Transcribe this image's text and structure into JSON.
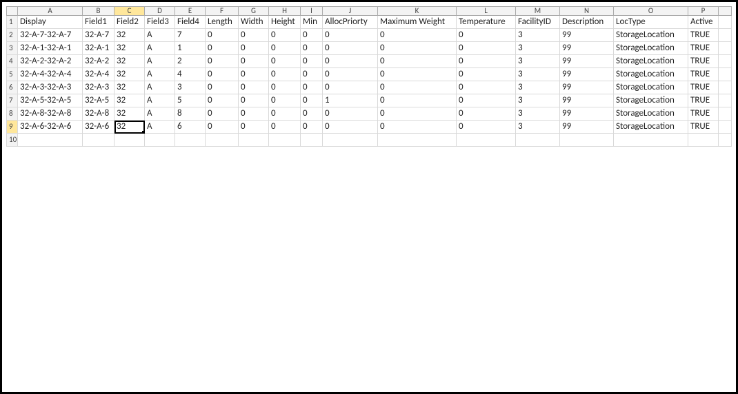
{
  "columnLetters": [
    "A",
    "B",
    "C",
    "D",
    "E",
    "F",
    "G",
    "H",
    "I",
    "J",
    "K",
    "L",
    "M",
    "N",
    "O",
    "P"
  ],
  "headerRowNumber": "1",
  "headers": {
    "Display": "Display",
    "Field1": "Field1",
    "Field2": "Field2",
    "Field3": "Field3",
    "Field4": "Field4",
    "Length": "Length",
    "Width": "Width",
    "Height": "Height",
    "Min": "Min",
    "AllocPriorty": "AllocPriorty",
    "MaximumWeight": "Maximum Weight",
    "Temperature": "Temperature",
    "FacilityID": "FacilityID",
    "Description": "Description",
    "LocType": "LocType",
    "Active": "Active"
  },
  "rows": [
    {
      "num": "2",
      "Display": "32-A-7-32-A-7",
      "Field1": "32-A-7",
      "Field2": "32",
      "Field3": "A",
      "Field4": "7",
      "Length": "0",
      "Width": "0",
      "Height": "0",
      "Min": "0",
      "AllocPriorty": "0",
      "MaximumWeight": "0",
      "Temperature": "0",
      "FacilityID": "3",
      "Description": "99",
      "LocType": "StorageLocation",
      "Active": "TRUE"
    },
    {
      "num": "3",
      "Display": "32-A-1-32-A-1",
      "Field1": "32-A-1",
      "Field2": "32",
      "Field3": "A",
      "Field4": "1",
      "Length": "0",
      "Width": "0",
      "Height": "0",
      "Min": "0",
      "AllocPriorty": "0",
      "MaximumWeight": "0",
      "Temperature": "0",
      "FacilityID": "3",
      "Description": "99",
      "LocType": "StorageLocation",
      "Active": "TRUE"
    },
    {
      "num": "4",
      "Display": "32-A-2-32-A-2",
      "Field1": "32-A-2",
      "Field2": "32",
      "Field3": "A",
      "Field4": "2",
      "Length": "0",
      "Width": "0",
      "Height": "0",
      "Min": "0",
      "AllocPriorty": "0",
      "MaximumWeight": "0",
      "Temperature": "0",
      "FacilityID": "3",
      "Description": "99",
      "LocType": "StorageLocation",
      "Active": "TRUE"
    },
    {
      "num": "5",
      "Display": "32-A-4-32-A-4",
      "Field1": "32-A-4",
      "Field2": "32",
      "Field3": "A",
      "Field4": "4",
      "Length": "0",
      "Width": "0",
      "Height": "0",
      "Min": "0",
      "AllocPriorty": "0",
      "MaximumWeight": "0",
      "Temperature": "0",
      "FacilityID": "3",
      "Description": "99",
      "LocType": "StorageLocation",
      "Active": "TRUE"
    },
    {
      "num": "6",
      "Display": "32-A-3-32-A-3",
      "Field1": "32-A-3",
      "Field2": "32",
      "Field3": "A",
      "Field4": "3",
      "Length": "0",
      "Width": "0",
      "Height": "0",
      "Min": "0",
      "AllocPriorty": "0",
      "MaximumWeight": "0",
      "Temperature": "0",
      "FacilityID": "3",
      "Description": "99",
      "LocType": "StorageLocation",
      "Active": "TRUE"
    },
    {
      "num": "7",
      "Display": "32-A-5-32-A-5",
      "Field1": "32-A-5",
      "Field2": "32",
      "Field3": "A",
      "Field4": "5",
      "Length": "0",
      "Width": "0",
      "Height": "0",
      "Min": "0",
      "AllocPriorty": "1",
      "MaximumWeight": "0",
      "Temperature": "0",
      "FacilityID": "3",
      "Description": "99",
      "LocType": "StorageLocation",
      "Active": "TRUE"
    },
    {
      "num": "8",
      "Display": "32-A-8-32-A-8",
      "Field1": "32-A-8",
      "Field2": "32",
      "Field3": "A",
      "Field4": "8",
      "Length": "0",
      "Width": "0",
      "Height": "0",
      "Min": "0",
      "AllocPriorty": "0",
      "MaximumWeight": "0",
      "Temperature": "0",
      "FacilityID": "3",
      "Description": "99",
      "LocType": "StorageLocation",
      "Active": "TRUE"
    },
    {
      "num": "9",
      "Display": "32-A-6-32-A-6",
      "Field1": "32-A-6",
      "Field2": "32",
      "Field3": "A",
      "Field4": "6",
      "Length": "0",
      "Width": "0",
      "Height": "0",
      "Min": "0",
      "AllocPriorty": "0",
      "MaximumWeight": "0",
      "Temperature": "0",
      "FacilityID": "3",
      "Description": "99",
      "LocType": "StorageLocation",
      "Active": "TRUE"
    }
  ],
  "emptyRowNumber": "10",
  "activeCell": {
    "row": "9",
    "col": "C"
  }
}
